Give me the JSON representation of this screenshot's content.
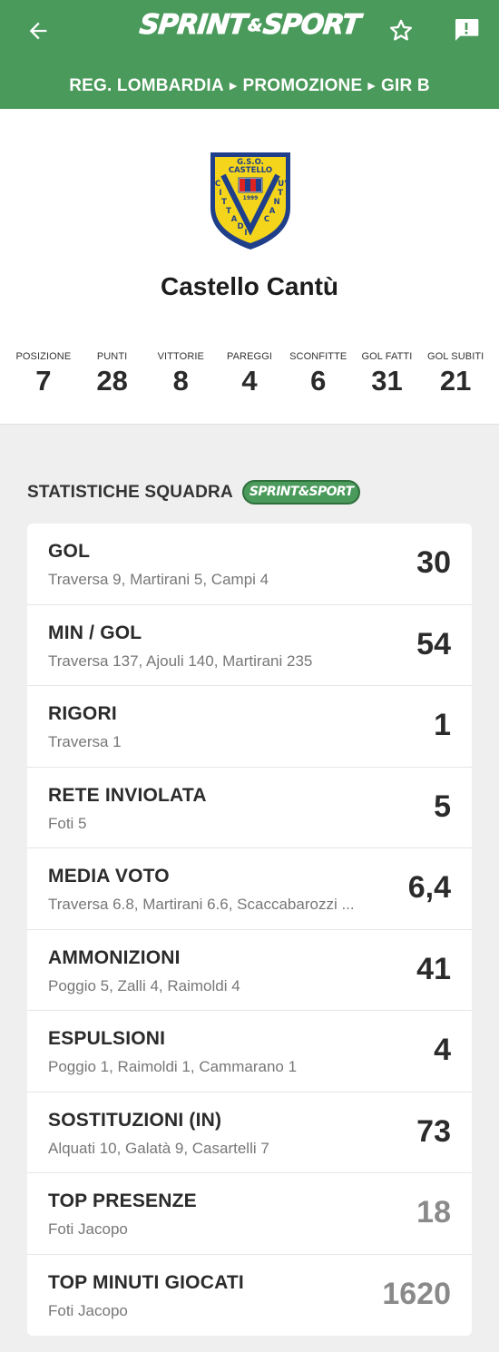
{
  "colors": {
    "header_bg": "#4a9a5b",
    "page_bg": "#efefef",
    "card_bg": "#ffffff",
    "muted_value": "#8a8a8a"
  },
  "header": {
    "logo_left": "SPRINT",
    "logo_amp": "&",
    "logo_right": "SPORT",
    "breadcrumb": [
      "REG. LOMBARDIA",
      "PROMOZIONE",
      "GIR B"
    ],
    "icons": {
      "back": "arrow-left-icon",
      "favorite": "star-outline-icon",
      "report": "alert-message-icon"
    }
  },
  "team": {
    "badge": {
      "top_text": "G.S.O.",
      "club_text": "CASTELLO",
      "year": "1999",
      "ring_letters": "CITTA DI CANTU"
    },
    "name": "Castello Cantù",
    "stats": [
      {
        "label": "POSIZIONE",
        "value": "7"
      },
      {
        "label": "PUNTI",
        "value": "28"
      },
      {
        "label": "VITTORIE",
        "value": "8"
      },
      {
        "label": "PAREGGI",
        "value": "4"
      },
      {
        "label": "SCONFITTE",
        "value": "6"
      },
      {
        "label": "GOL FATTI",
        "value": "31"
      },
      {
        "label": "GOL SUBITI",
        "value": "21"
      }
    ]
  },
  "section": {
    "title": "STATISTICHE SQUADRA",
    "logo_text": "SPRINT&SPORT"
  },
  "stats_list": [
    {
      "title": "GOL",
      "subtitle": "Traversa 9, Martirani 5, Campi 4",
      "value": "30",
      "muted": false
    },
    {
      "title": "MIN / GOL",
      "subtitle": "Traversa 137, Ajouli 140, Martirani 235",
      "value": "54",
      "muted": false
    },
    {
      "title": "RIGORI",
      "subtitle": "Traversa 1",
      "value": "1",
      "muted": false
    },
    {
      "title": "RETE INVIOLATA",
      "subtitle": "Foti 5",
      "value": "5",
      "muted": false
    },
    {
      "title": "MEDIA VOTO",
      "subtitle": "Traversa 6.8, Martirani 6.6, Scaccabarozzi ...",
      "value": "6,4",
      "muted": false
    },
    {
      "title": "AMMONIZIONI",
      "subtitle": "Poggio 5, Zalli 4, Raimoldi 4",
      "value": "41",
      "muted": false
    },
    {
      "title": "ESPULSIONI",
      "subtitle": "Poggio 1, Raimoldi 1, Cammarano 1",
      "value": "4",
      "muted": false
    },
    {
      "title": "SOSTITUZIONI (IN)",
      "subtitle": "Alquati 10, Galatà 9, Casartelli 7",
      "value": "73",
      "muted": false
    },
    {
      "title": "TOP PRESENZE",
      "subtitle": "Foti Jacopo",
      "value": "18",
      "muted": true
    },
    {
      "title": "TOP MINUTI GIOCATI",
      "subtitle": "Foti Jacopo",
      "value": "1620",
      "muted": true
    }
  ]
}
